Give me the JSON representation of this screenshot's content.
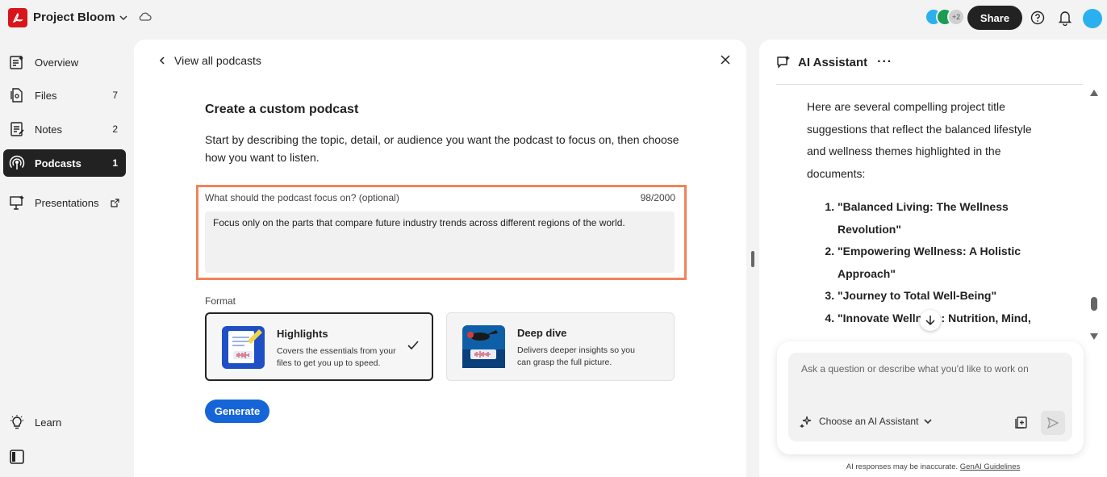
{
  "header": {
    "project_title": "Project Bloom",
    "avatar_overflow": "+2",
    "share_label": "Share"
  },
  "sidebar": {
    "items": [
      {
        "label": "Overview",
        "count": ""
      },
      {
        "label": "Files",
        "count": "7"
      },
      {
        "label": "Notes",
        "count": "2"
      },
      {
        "label": "Podcasts",
        "count": "1"
      },
      {
        "label": "Presentations",
        "count": ""
      }
    ],
    "learn_label": "Learn"
  },
  "main": {
    "back_label": "View all podcasts",
    "heading": "Create a custom podcast",
    "description": "Start by describing the topic, detail, or audience you want the podcast to focus on, then choose how you want to listen.",
    "focus": {
      "label": "What should the podcast focus on? (optional)",
      "count": "98/2000",
      "value": "Focus only on the parts that compare future industry trends across different regions of the world."
    },
    "format_label": "Format",
    "formats": [
      {
        "title": "Highlights",
        "description": "Covers the essentials from your files to get you up to speed.",
        "selected": true
      },
      {
        "title": "Deep dive",
        "description": "Delivers deeper insights so you can grasp the full picture.",
        "selected": false
      }
    ],
    "generate_label": "Generate"
  },
  "assistant": {
    "title": "AI Assistant",
    "intro": "Here are several compelling project title suggestions that reflect the balanced lifestyle and wellness themes highlighted in the documents:",
    "suggestions": [
      "\"Balanced Living: The Wellness Revolution\"",
      "\"Empowering Wellness: A Holistic Approach\"",
      "\"Journey to Total Well-Being\"",
      "\"Innovate Wellness: Nutrition, Mind, and Movement\""
    ],
    "input_placeholder": "Ask a question or describe what you'd like to work on",
    "choose_label": "Choose an AI Assistant",
    "disclaimer": "AI responses may be inaccurate.",
    "guidelines_link": "GenAI Guidelines"
  },
  "colors": {
    "accent_blue": "#1565d8",
    "highlight_border": "#f0845a",
    "brand_red": "#d7151b"
  }
}
